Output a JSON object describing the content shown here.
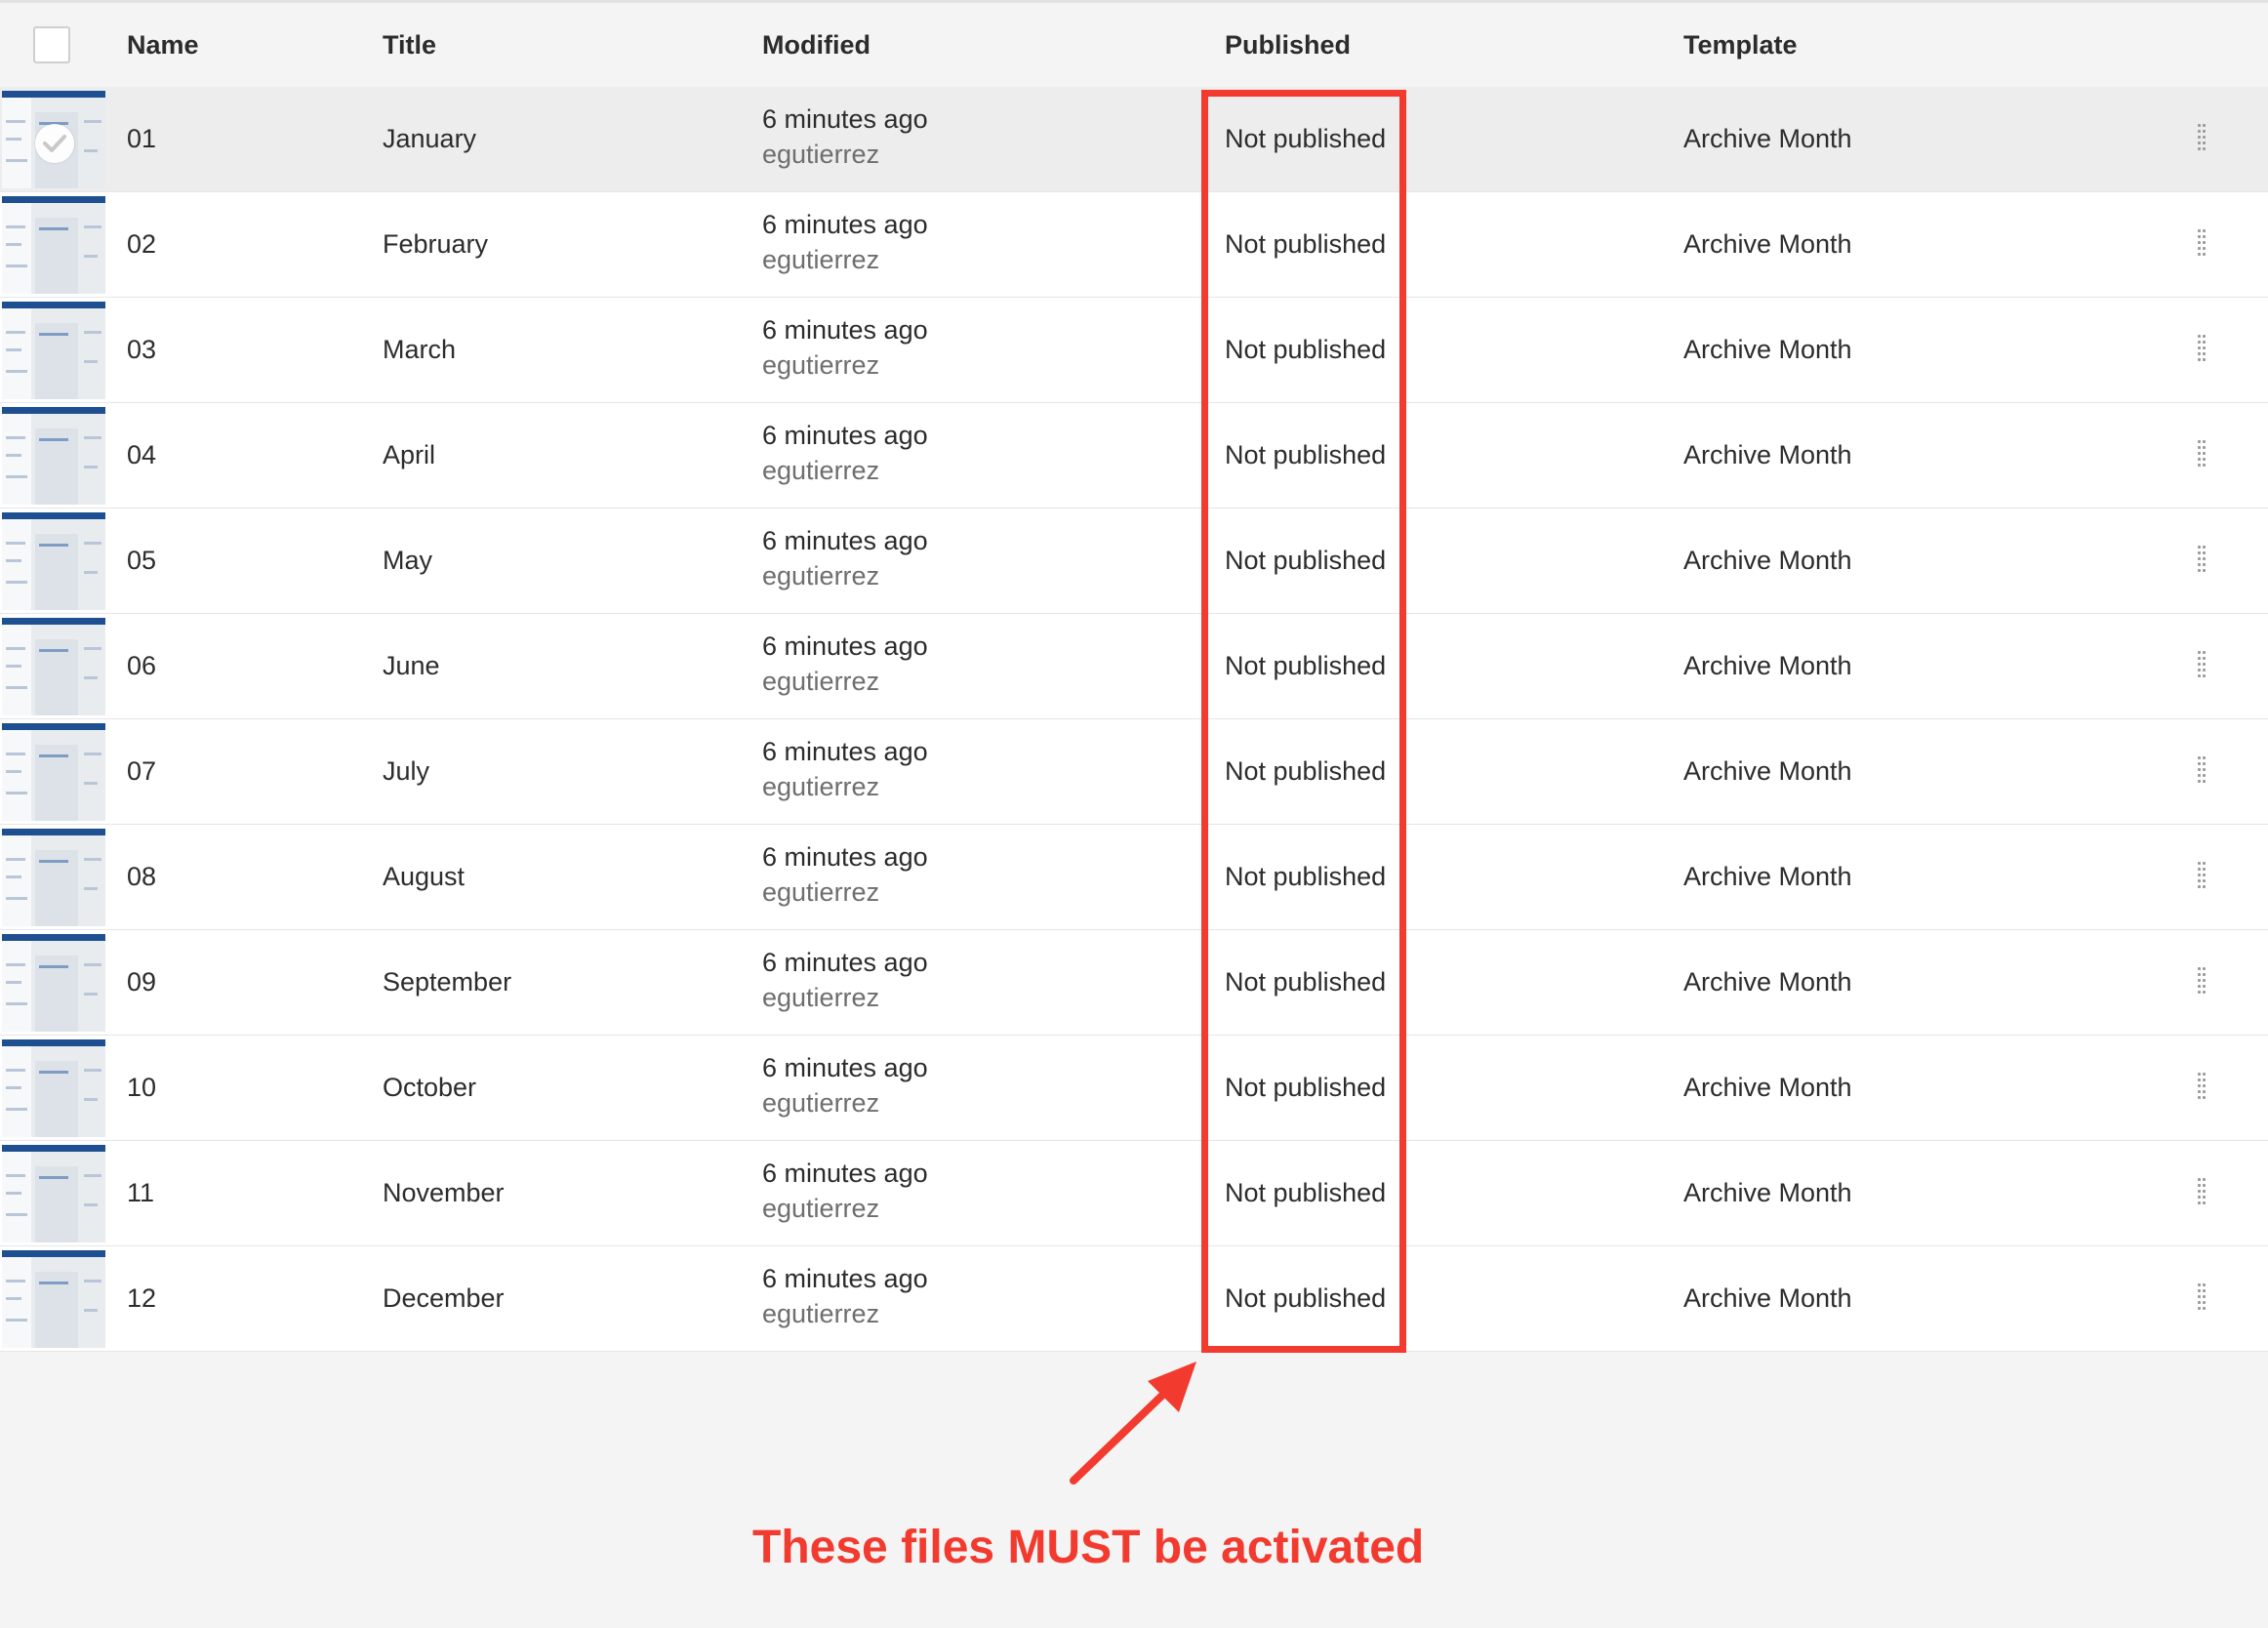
{
  "table": {
    "columns": {
      "name": "Name",
      "title": "Title",
      "modified": "Modified",
      "published": "Published",
      "template": "Template"
    },
    "rows": [
      {
        "name": "01",
        "title": "January",
        "modified": "6 minutes ago",
        "modified_by": "egutierrez",
        "published": "Not published",
        "template": "Archive Month",
        "selected": true
      },
      {
        "name": "02",
        "title": "February",
        "modified": "6 minutes ago",
        "modified_by": "egutierrez",
        "published": "Not published",
        "template": "Archive Month"
      },
      {
        "name": "03",
        "title": "March",
        "modified": "6 minutes ago",
        "modified_by": "egutierrez",
        "published": "Not published",
        "template": "Archive Month"
      },
      {
        "name": "04",
        "title": "April",
        "modified": "6 minutes ago",
        "modified_by": "egutierrez",
        "published": "Not published",
        "template": "Archive Month"
      },
      {
        "name": "05",
        "title": "May",
        "modified": "6 minutes ago",
        "modified_by": "egutierrez",
        "published": "Not published",
        "template": "Archive Month"
      },
      {
        "name": "06",
        "title": "June",
        "modified": "6 minutes ago",
        "modified_by": "egutierrez",
        "published": "Not published",
        "template": "Archive Month"
      },
      {
        "name": "07",
        "title": "July",
        "modified": "6 minutes ago",
        "modified_by": "egutierrez",
        "published": "Not published",
        "template": "Archive Month"
      },
      {
        "name": "08",
        "title": "August",
        "modified": "6 minutes ago",
        "modified_by": "egutierrez",
        "published": "Not published",
        "template": "Archive Month"
      },
      {
        "name": "09",
        "title": "September",
        "modified": "6 minutes ago",
        "modified_by": "egutierrez",
        "published": "Not published",
        "template": "Archive Month"
      },
      {
        "name": "10",
        "title": "October",
        "modified": "6 minutes ago",
        "modified_by": "egutierrez",
        "published": "Not published",
        "template": "Archive Month"
      },
      {
        "name": "11",
        "title": "November",
        "modified": "6 minutes ago",
        "modified_by": "egutierrez",
        "published": "Not published",
        "template": "Archive Month"
      },
      {
        "name": "12",
        "title": "December",
        "modified": "6 minutes ago",
        "modified_by": "egutierrez",
        "published": "Not published",
        "template": "Archive Month"
      }
    ]
  },
  "annotation": {
    "text": "These files MUST be activated",
    "color": "#f23a2f"
  },
  "icons": {
    "row_thumbnail": "page-thumbnail-icon",
    "row_selected": "checkmark-icon",
    "row_actions": "drag-handle-icon",
    "select_all": "checkbox-icon",
    "annotation_arrow": "arrow-icon"
  }
}
